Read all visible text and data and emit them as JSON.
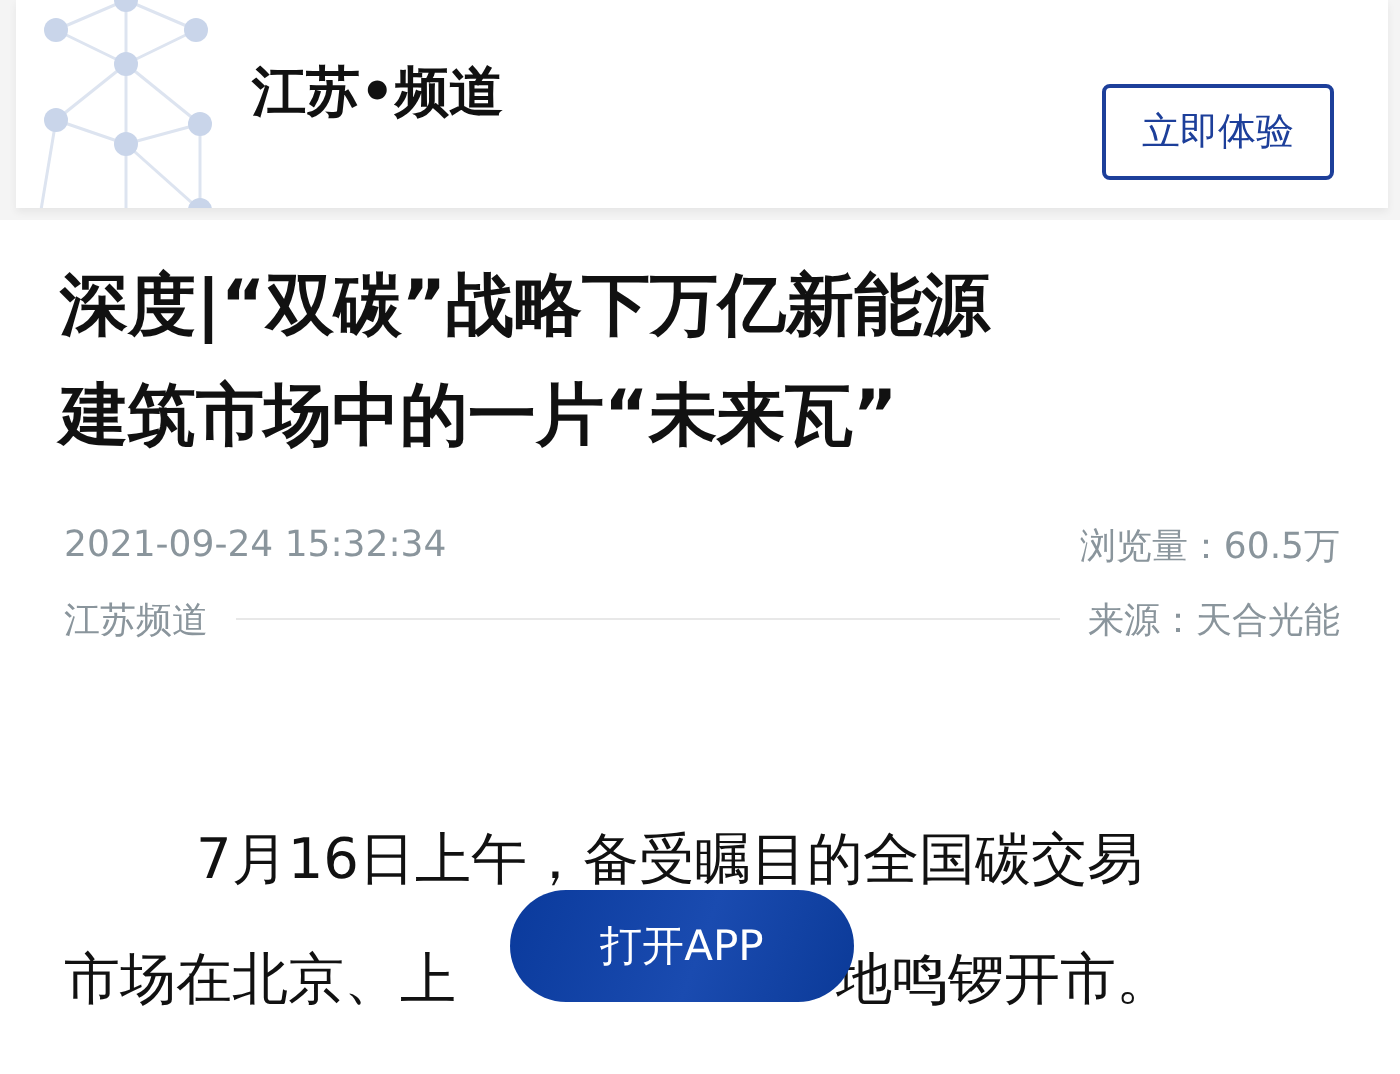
{
  "header": {
    "channel_title": "江苏•频道",
    "try_button": "立即体验"
  },
  "article": {
    "headline_lines": [
      "深度|“双碳”战略下万亿新能源",
      "建筑市场中的一片“未来瓦”"
    ],
    "datetime": "2021-09-24 15:32:34",
    "views": "浏览量：60.5万",
    "channel": "江苏频道",
    "source": "来源：天合光能",
    "body_line_1": "7月16日上午，备受瞩目的全国碳交易",
    "body_line_2_start": "市场在北京、上",
    "body_line_2_end": "地鸣锣开市。"
  },
  "open_app_button": "打开APP"
}
